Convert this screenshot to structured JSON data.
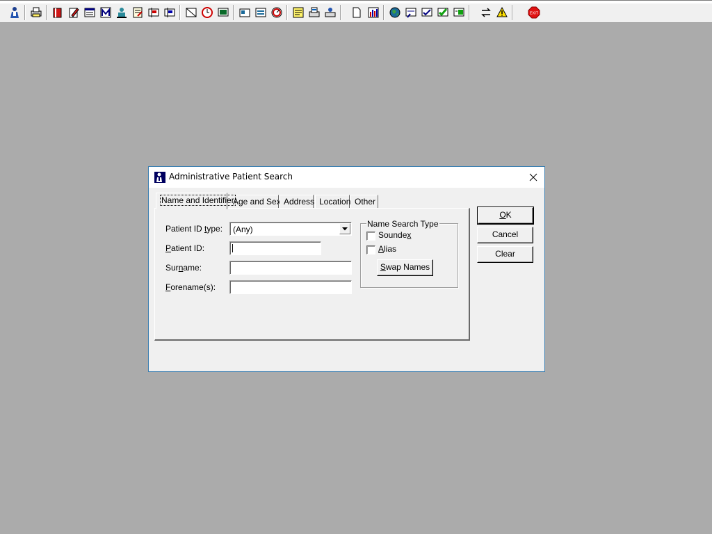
{
  "toolbar": {
    "icons": [
      "patient-search-icon",
      "printer-icon",
      "book-icon",
      "edit-notes-icon",
      "list-window-icon",
      "letter-m-icon",
      "person-icon",
      "document-edit-icon",
      "flag-icon",
      "flag-alt-icon",
      "no-image-icon",
      "clock-icon",
      "monitor-icon",
      "card-icon",
      "form-icon",
      "speedometer-icon",
      "note-icon",
      "print-form-icon",
      "print-person-icon",
      "page-icon",
      "bar-chart-icon",
      "globe-icon",
      "forms-icon",
      "forms-check-icon",
      "forms-green-icon",
      "forms-green-alt-icon",
      "switch-icon",
      "warning-icon",
      "exit-icon"
    ],
    "exit_label": "EXIT"
  },
  "dialog": {
    "title": "Administrative Patient Search",
    "tabs": [
      "Name and Identifier",
      "Age and Sex",
      "Address",
      "Location",
      "Other"
    ],
    "active_tab": "Name and Identifier",
    "fields": {
      "patient_id_type_label_pre": "Patient ID ",
      "patient_id_type_label_u": "t",
      "patient_id_type_label_post": "ype:",
      "patient_id_type_value": "(Any)",
      "patient_id_label_u": "P",
      "patient_id_label_post": "atient ID:",
      "patient_id_value": "",
      "surname_label_pre": "Sur",
      "surname_label_u": "n",
      "surname_label_post": "ame:",
      "surname_value": "",
      "forename_label_u": "F",
      "forename_label_post": "orename(s):",
      "forename_value": ""
    },
    "name_search_type": {
      "legend": "Name Search Type",
      "soundex_pre": "Sounde",
      "soundex_u": "x",
      "soundex_checked": false,
      "alias_u": "A",
      "alias_post": "lias",
      "alias_checked": false,
      "swap_names_u": "S",
      "swap_names_post": "wap Names"
    },
    "buttons": {
      "ok_u": "O",
      "ok_post": "K",
      "cancel": "Cancel",
      "clear": "Clear"
    }
  }
}
